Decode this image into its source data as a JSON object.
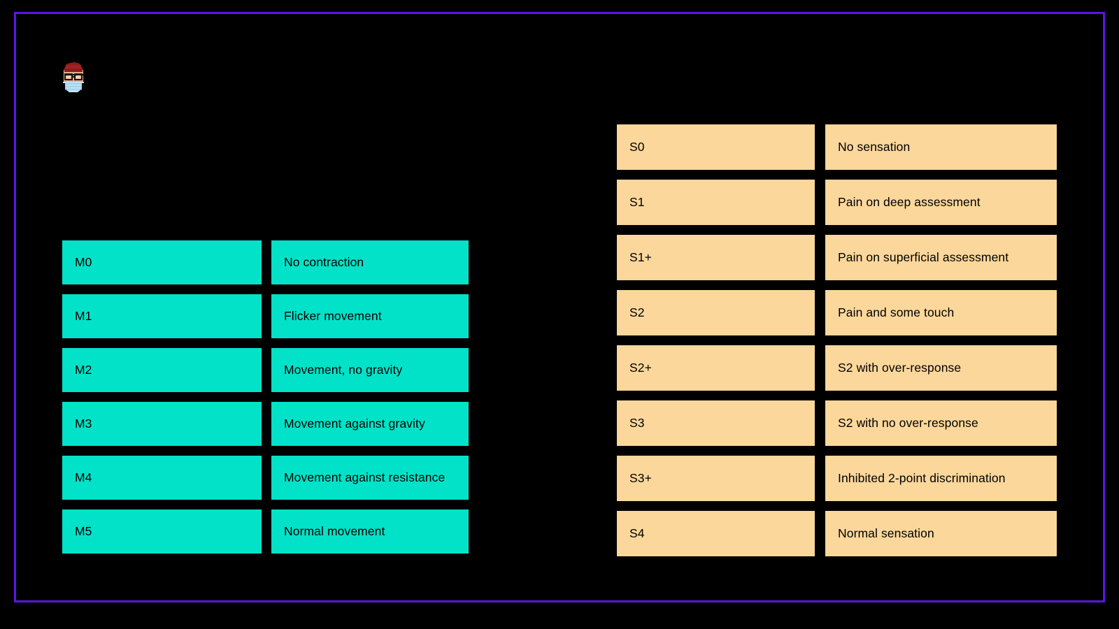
{
  "page": {
    "background_color": "#000000",
    "frame_color": "#5B15E6"
  },
  "avatar": {
    "name": "masked-person-avatar",
    "hair_color": "#8E1C1C",
    "skin_color": "#E8B08E",
    "glasses_color": "#111111",
    "mask_color": "#BFE2F5"
  },
  "motor_table": {
    "name": "motor-grading-table",
    "accent_color": "#02E2C8",
    "rows": [
      {
        "code": "M0",
        "description": "No contraction"
      },
      {
        "code": "M1",
        "description": "Flicker movement"
      },
      {
        "code": "M2",
        "description": "Movement, no gravity"
      },
      {
        "code": "M3",
        "description": "Movement against gravity"
      },
      {
        "code": "M4",
        "description": "Movement against resistance"
      },
      {
        "code": "M5",
        "description": "Normal movement"
      }
    ]
  },
  "sensory_table": {
    "name": "sensory-grading-table",
    "accent_color": "#FBD79B",
    "rows": [
      {
        "code": "S0",
        "description": "No sensation"
      },
      {
        "code": "S1",
        "description": "Pain on deep assessment"
      },
      {
        "code": "S1+",
        "description": "Pain on superficial assessment"
      },
      {
        "code": "S2",
        "description": "Pain and some touch"
      },
      {
        "code": "S2+",
        "description": "S2 with over-response"
      },
      {
        "code": "S3",
        "description": "S2 with no over-response"
      },
      {
        "code": "S3+",
        "description": "Inhibited 2-point discrimination"
      },
      {
        "code": "S4",
        "description": "Normal sensation"
      }
    ]
  }
}
